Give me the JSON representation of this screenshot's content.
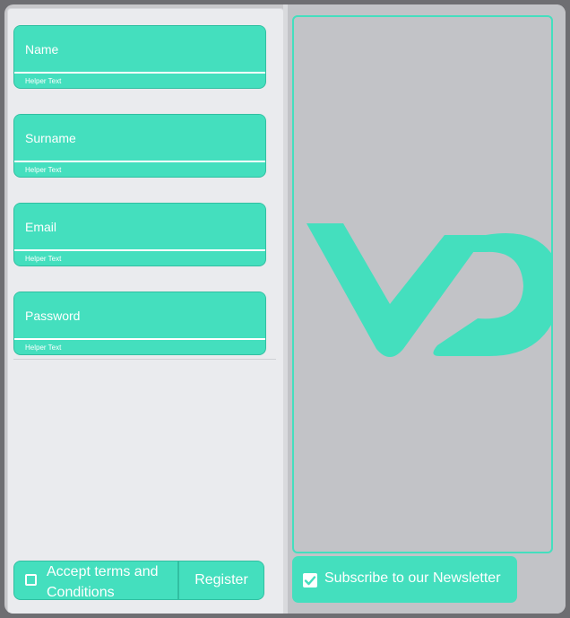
{
  "form": {
    "fields": [
      {
        "placeholder": "Name",
        "helper": "Helper Text"
      },
      {
        "placeholder": "Surname",
        "helper": "Helper Text"
      },
      {
        "placeholder": "Email",
        "helper": "Helper Text"
      },
      {
        "placeholder": "Password",
        "helper": "Helper Text"
      }
    ],
    "terms_label": "Accept terms and Conditions",
    "register_label": "Register",
    "terms_checked": false
  },
  "aside": {
    "logo_icon": "vd-logo-icon",
    "newsletter_label": "Subscribe to our Newsletter",
    "newsletter_checked": true
  },
  "colors": {
    "accent": "#44dfbe",
    "panel": "#eaebee",
    "aside_bg": "#c2c3c7",
    "frame": "#6e6e72"
  }
}
